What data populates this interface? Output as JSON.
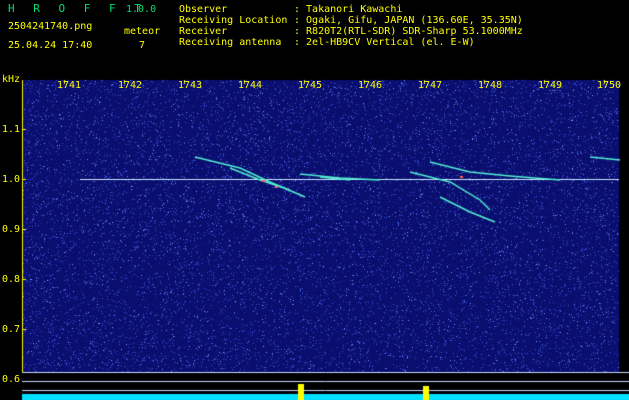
{
  "header": {
    "title": "H R O F F T",
    "version": "1.0.0",
    "filename": "2504241740.png",
    "datetime": "25.04.24 17:40",
    "meteor_label": "meteor",
    "meteor_count": "7"
  },
  "info": {
    "items": [
      {
        "label": "Observer",
        "value": ": Takanori Kawachi"
      },
      {
        "label": "Receiving Location",
        "value": ": Ogaki, Gifu, JAPAN (136.60E, 35.35N)"
      },
      {
        "label": "Receiver",
        "value": ": R820T2(RTL-SDR) SDR-Sharp 53.1000MHz"
      },
      {
        "label": "Receiving antenna",
        "value": ": 2el-HB9CV Vertical (el. E-W)"
      }
    ]
  },
  "spectrogram": {
    "unit": "kHz",
    "x_ticks": [
      "1741",
      "1742",
      "1743",
      "1744",
      "1745",
      "1746",
      "1747",
      "1748",
      "1749",
      "1750"
    ],
    "y_ticks": [
      "1.1",
      "1.0",
      "0.9",
      "0.8",
      "0.7",
      "0.6"
    ],
    "colors": {
      "background": "#0a0e6e",
      "noise": "#3a52d8",
      "carrier": "#c8e8ff",
      "trace": "#50f0d0",
      "axis": "#ffff00",
      "baseline": "#00e0ff"
    }
  }
}
